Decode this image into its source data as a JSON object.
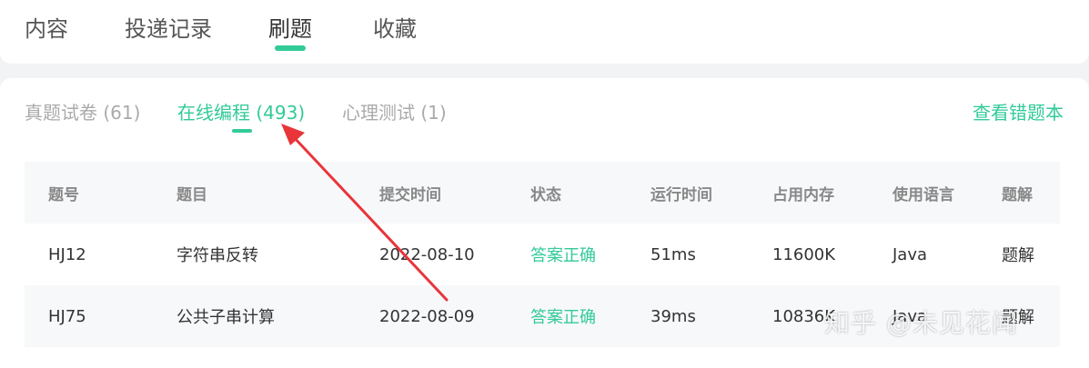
{
  "top_tabs": [
    {
      "label": "内容"
    },
    {
      "label": "投递记录"
    },
    {
      "label": "刷题",
      "active": true
    },
    {
      "label": "收藏"
    }
  ],
  "sub_tabs": [
    {
      "label": "真题试卷 (61)"
    },
    {
      "label": "在线编程 (493)",
      "active": true
    },
    {
      "label": "心理测试 (1)"
    }
  ],
  "wrong_book_link": "查看错题本",
  "table": {
    "headers": [
      "题号",
      "题目",
      "提交时间",
      "状态",
      "运行时间",
      "占用内存",
      "使用语言",
      "题解"
    ],
    "rows": [
      [
        "HJ12",
        "字符串反转",
        "2022-08-10",
        "答案正确",
        "51ms",
        "11600K",
        "Java",
        "题解"
      ],
      [
        "HJ75",
        "公共子串计算",
        "2022-08-09",
        "答案正确",
        "39ms",
        "10836K",
        "Java",
        "题解"
      ]
    ]
  },
  "watermark": "知乎 @未见花闻",
  "colors": {
    "accent": "#32ca99",
    "arrow": "#e8353a"
  }
}
